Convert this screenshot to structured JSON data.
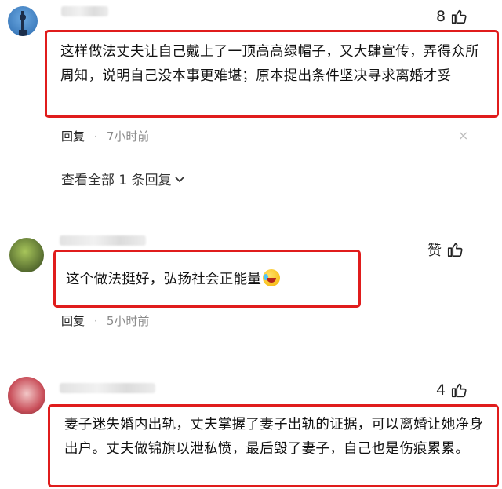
{
  "comments": [
    {
      "likes": "8",
      "text": "这样做法丈夫让自己戴上了一顶高高绿帽子，又大肆宣传，弄得众所周知，说明自己没本事更难堪；原本提出条件坚决寻求离婚才妥",
      "reply_label": "回复",
      "dot": "·",
      "time": "7小时前",
      "close": "×",
      "view_all": "查看全部 1 条回复"
    },
    {
      "likes": "赞",
      "text": "这个做法挺好，弘扬社会正能量",
      "reply_label": "回复",
      "dot": "·",
      "time": "5小时前"
    },
    {
      "likes": "4",
      "text": "妻子迷失婚内出轨，丈夫掌握了妻子出轨的证据，可以离婚让她净身出户。丈夫做锦旗以泄私愤，最后毁了妻子，自己也是伤痕累累。"
    }
  ],
  "colors": {
    "highlight": "#e01c1c",
    "meta_time": "#8a8a8a"
  },
  "icons": [
    "thumbs-up-icon",
    "close-icon",
    "chevron-down-icon",
    "laughing-emoji-icon"
  ]
}
